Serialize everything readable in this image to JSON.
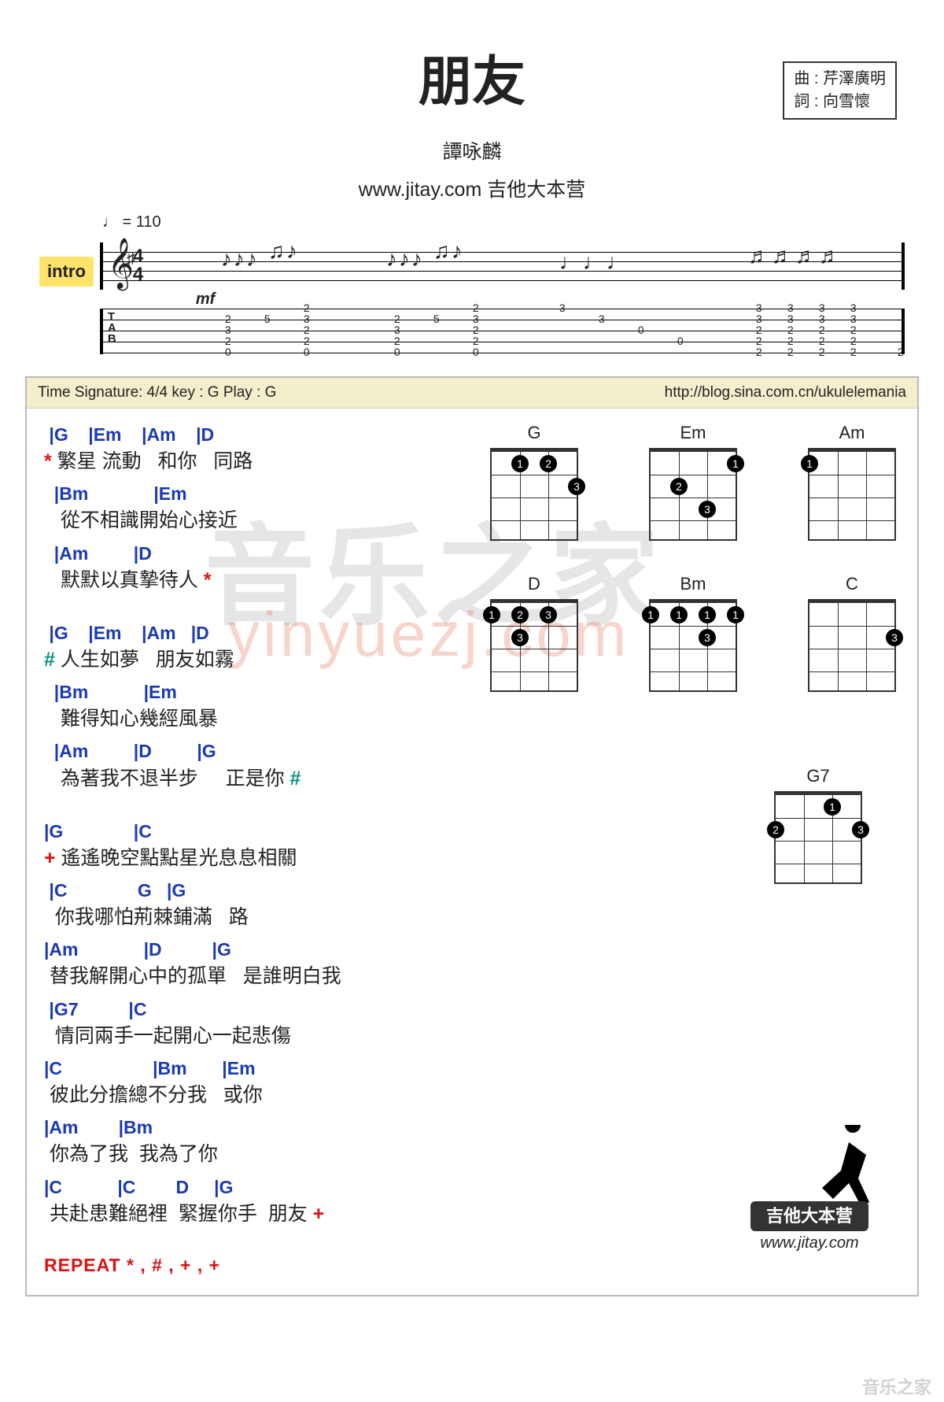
{
  "header": {
    "title": "朋友",
    "composer_label": "曲",
    "composer": "芹澤廣明",
    "lyricist_label": "詞",
    "lyricist": "向雪懷",
    "artist": "譚咏麟",
    "site": "www.jitay.com 吉他大本营",
    "tempo": "♩ = 110",
    "intro_label": "intro",
    "dynamic": "mf",
    "time_sig_top": "4",
    "time_sig_bottom": "4",
    "tab_label": "T\nA\nB"
  },
  "chart_meta": {
    "left": "Time Signature: 4/4   key : G   Play : G",
    "right": "http://blog.sina.com.cn/ukulelemania"
  },
  "chord_diagrams": [
    {
      "name": "G",
      "dots": [
        {
          "s": 1,
          "f": 1,
          "n": "1"
        },
        {
          "s": 2,
          "f": 1,
          "n": "2"
        },
        {
          "s": 3,
          "f": 2,
          "n": "3"
        }
      ]
    },
    {
      "name": "Em",
      "dots": [
        {
          "s": 3,
          "f": 1,
          "n": "1"
        },
        {
          "s": 1,
          "f": 2,
          "n": "2"
        },
        {
          "s": 2,
          "f": 3,
          "n": "3"
        }
      ]
    },
    {
      "name": "Am",
      "dots": [
        {
          "s": 0,
          "f": 1,
          "n": "1"
        }
      ]
    },
    {
      "name": "D",
      "dots": [
        {
          "s": 0,
          "f": 1,
          "n": "1"
        },
        {
          "s": 1,
          "f": 1,
          "n": "2"
        },
        {
          "s": 2,
          "f": 1,
          "n": "3"
        },
        {
          "s": 1,
          "f": 2,
          "n": "3"
        }
      ]
    },
    {
      "name": "Bm",
      "dots": [
        {
          "s": 0,
          "f": 1,
          "n": "1"
        },
        {
          "s": 1,
          "f": 1,
          "n": "1"
        },
        {
          "s": 2,
          "f": 1,
          "n": "1"
        },
        {
          "s": 3,
          "f": 1,
          "n": "1"
        },
        {
          "s": 2,
          "f": 2,
          "n": "3"
        }
      ]
    },
    {
      "name": "C",
      "dots": [
        {
          "s": 3,
          "f": 2,
          "n": "3"
        }
      ]
    }
  ],
  "extra_diagram": {
    "name": "G7",
    "dots": [
      {
        "s": 2,
        "f": 1,
        "n": "1"
      },
      {
        "s": 0,
        "f": 2,
        "n": "2"
      },
      {
        "s": 3,
        "f": 2,
        "n": "3"
      }
    ]
  },
  "sections": [
    {
      "marker": "*",
      "marker_class": "mark-red",
      "end_marker": "*",
      "lines": [
        {
          "chords": " |G    |Em    |Am    |D",
          "lyric": " 繁星 流動   和你   同路"
        },
        {
          "chords": "  |Bm             |Em",
          "lyric": "   從不相識開始心接近"
        },
        {
          "chords": "  |Am         |D",
          "lyric": "   默默以真摯待人"
        }
      ]
    },
    {
      "marker": "#",
      "marker_class": "mark-teal",
      "end_marker": "#",
      "lines": [
        {
          "chords": " |G    |Em    |Am   |D",
          "lyric": " 人生如夢   朋友如霧"
        },
        {
          "chords": "  |Bm           |Em",
          "lyric": "   難得知心幾經風暴"
        },
        {
          "chords": "  |Am         |D         |G",
          "lyric": "   為著我不退半步     正是你"
        }
      ]
    },
    {
      "marker": "+",
      "marker_class": "mark-red",
      "end_marker": "+",
      "lines": [
        {
          "chords": "|G              |C",
          "lyric": " 遙遙晚空點點星光息息相關"
        },
        {
          "chords": " |C              G   |G",
          "lyric": "  你我哪怕荊棘鋪滿   路"
        },
        {
          "chords": "|Am             |D          |G",
          "lyric": " 替我解開心中的孤單   是誰明白我"
        },
        {
          "chords": " |G7          |C",
          "lyric": "  情同兩手一起開心一起悲傷"
        },
        {
          "chords": "|C                  |Bm       |Em",
          "lyric": " 彼此分擔總不分我   或你"
        },
        {
          "chords": "|Am        |Bm",
          "lyric": " 你為了我  我為了你"
        },
        {
          "chords": "|C           |C        D     |G",
          "lyric": " 共赴患難絕裡  緊握你手  朋友"
        }
      ]
    }
  ],
  "repeat": "REPEAT    * , # , + , +",
  "footer": {
    "badge": "吉他大本营",
    "site": "www.jitay.com"
  },
  "watermark": {
    "main": "音乐之家",
    "sub": "yinyuezj.com",
    "small": "音乐之家"
  },
  "intro_tab": {
    "positions": [
      155,
      205,
      255,
      370,
      420,
      470,
      580,
      630,
      680,
      730,
      830,
      870,
      910,
      950
    ],
    "cols": [
      [
        "",
        "2",
        "3",
        "2",
        "0"
      ],
      [
        "",
        "5",
        "",
        "",
        ""
      ],
      [
        "2",
        "3",
        "2",
        "2",
        "0"
      ],
      [
        "",
        "2",
        "3",
        "2",
        "0"
      ],
      [
        "",
        "5",
        "",
        "",
        ""
      ],
      [
        "2",
        "3",
        "2",
        "2",
        "0"
      ],
      [
        "3",
        "",
        "",
        "",
        ""
      ],
      [
        "",
        "3",
        "",
        "",
        ""
      ],
      [
        "",
        "",
        "0",
        "",
        ""
      ],
      [
        "",
        "",
        "",
        "0",
        ""
      ],
      [
        "3",
        "3",
        "2",
        "2",
        "2"
      ],
      [
        "3",
        "3",
        "2",
        "2",
        "2"
      ],
      [
        "3",
        "3",
        "2",
        "2",
        "2"
      ],
      [
        "3",
        "3",
        "2",
        "2",
        "2"
      ]
    ],
    "trail": {
      "pos": 1010,
      "col": [
        "",
        "",
        "",
        "",
        "2"
      ]
    }
  }
}
